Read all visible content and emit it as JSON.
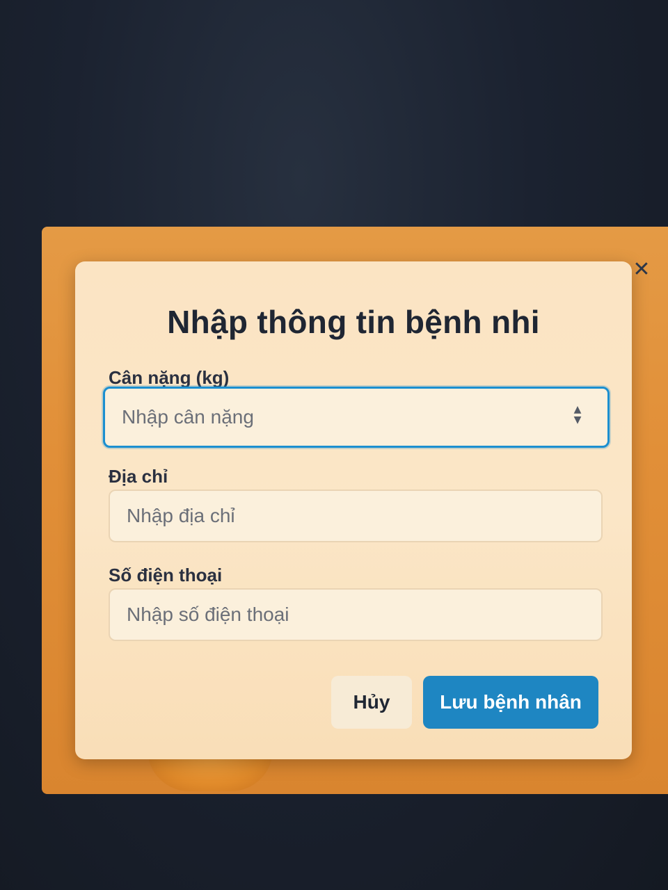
{
  "dialog": {
    "title": "Nhập thông tin bệnh nhi",
    "close_icon": "close-icon",
    "fields": {
      "weight": {
        "label": "Cân nặng (kg)",
        "placeholder": "Nhập cân nặng",
        "value": "",
        "spinner_icon": "number-spinner-icon"
      },
      "address": {
        "label": "Địa chỉ",
        "placeholder": "Nhập địa chỉ",
        "value": ""
      },
      "phone": {
        "label": "Số điện thoại",
        "placeholder": "Nhập số điện thoại",
        "value": ""
      }
    },
    "buttons": {
      "cancel": "Hủy",
      "save": "Lưu bệnh nhân"
    }
  },
  "colors": {
    "overlay": "#e18f38",
    "modal_bg": "#fbe4c3",
    "focus_border": "#1b8fd0",
    "primary_button": "#1e86c2"
  }
}
